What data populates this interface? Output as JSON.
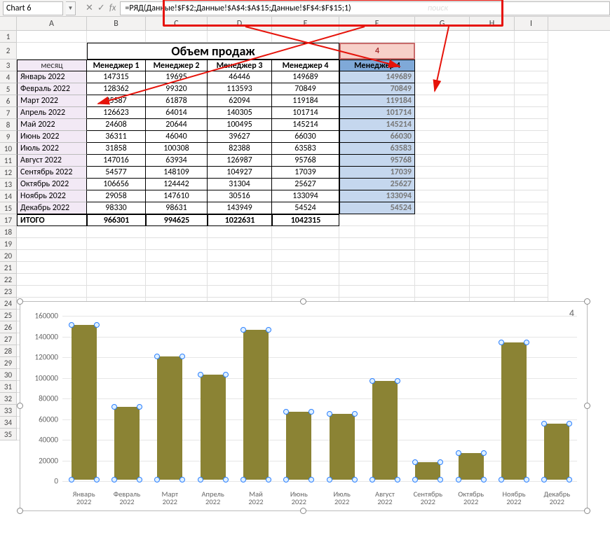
{
  "name_box": "Chart 6",
  "formula": "=РЯД(Данные!$F$2;Данные!$A$4:$A$15;Данные!$F$4:$F$15;1)",
  "formula_watermark": "поиск",
  "col_headers": [
    "A",
    "B",
    "C",
    "D",
    "E",
    "F",
    "G",
    "H",
    "I"
  ],
  "row_headers": [
    "1",
    "2",
    "3",
    "4",
    "5",
    "6",
    "7",
    "8",
    "9",
    "10",
    "11",
    "12",
    "13",
    "14",
    "15",
    "17",
    "18",
    "19",
    "20",
    "21",
    "22",
    "23",
    "24",
    "25",
    "26",
    "27",
    "28",
    "29",
    "30",
    "31",
    "32",
    "33",
    "34",
    "35"
  ],
  "title": "Объем продаж",
  "f2_value": "4",
  "header_a": "месяц",
  "managers": [
    "Менеджер 1",
    "Менеджер 2",
    "Менеджер 3",
    "Менеджер 4"
  ],
  "f_header": "Менеджер 4",
  "months": [
    "Январь 2022",
    "Февраль 2022",
    "Март 2022",
    "Апрель 2022",
    "Май 2022",
    "Июнь 2022",
    "Июль 2022",
    "Август 2022",
    "Сентябрь 2022",
    "Октябрь 2022",
    "Ноябрь 2022",
    "Декабрь 2022"
  ],
  "table": [
    [
      147315,
      19695,
      46446,
      149689
    ],
    [
      128362,
      99320,
      113593,
      70849
    ],
    [
      35587,
      61878,
      62094,
      119184
    ],
    [
      126623,
      64014,
      140305,
      101714
    ],
    [
      24608,
      20644,
      100495,
      145214
    ],
    [
      36311,
      46040,
      39627,
      66030
    ],
    [
      31858,
      100308,
      82388,
      63583
    ],
    [
      147016,
      63934,
      126987,
      95768
    ],
    [
      54577,
      148109,
      104927,
      17039
    ],
    [
      106656,
      124442,
      31304,
      25627
    ],
    [
      29058,
      147610,
      30516,
      133094
    ],
    [
      98330,
      98631,
      143949,
      54524
    ]
  ],
  "f_col": [
    149689,
    70849,
    119184,
    101714,
    145214,
    66030,
    63583,
    95768,
    17039,
    25627,
    133094,
    54524
  ],
  "itogo_label": "ИТОГО",
  "itogo": [
    966301,
    994625,
    1022631,
    1042315
  ],
  "chart_data": {
    "type": "bar",
    "title": "4",
    "categories": [
      "Январь 2022",
      "Февраль 2022",
      "Март 2022",
      "Апрель 2022",
      "Май 2022",
      "Июнь 2022",
      "Июль 2022",
      "Август 2022",
      "Сентябрь 2022",
      "Октябрь 2022",
      "Ноябрь 2022",
      "Декабрь 2022"
    ],
    "values": [
      149689,
      70849,
      119184,
      101714,
      145214,
      66030,
      63583,
      95768,
      17039,
      25627,
      133094,
      54524
    ],
    "ylim": [
      0,
      160000
    ],
    "yticks": [
      0,
      20000,
      40000,
      60000,
      80000,
      100000,
      120000,
      140000,
      160000
    ],
    "xlabel": "",
    "ylabel": ""
  }
}
